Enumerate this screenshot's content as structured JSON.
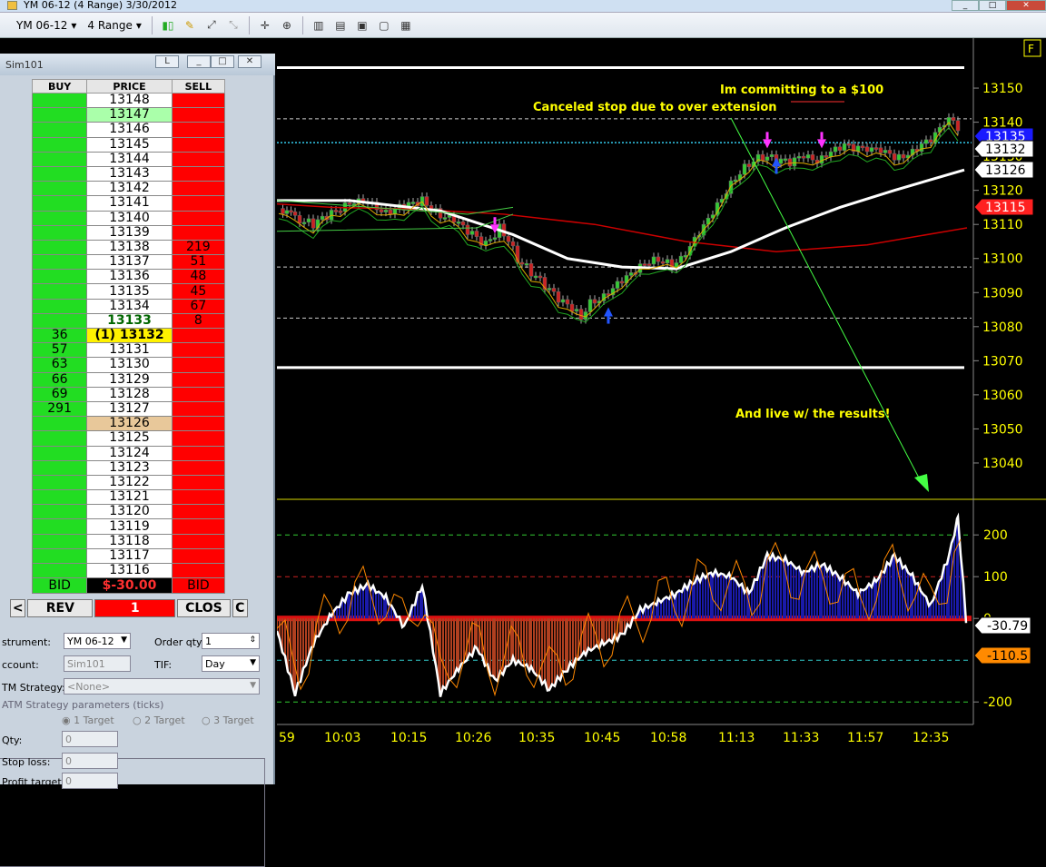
{
  "window": {
    "title": "YM 06-12 (4 Range)  3/30/2012"
  },
  "toolbar": {
    "instrument": "YM 06-12",
    "bar_type": "4 Range"
  },
  "dom": {
    "title": "Sim101",
    "link_button": "L",
    "headers": {
      "buy": "BUY",
      "price": "PRICE",
      "sell": "SELL"
    },
    "rows": [
      {
        "buy": "",
        "price": "13148",
        "sell": ""
      },
      {
        "buy": "",
        "price": "13147",
        "sell": "",
        "style": "last"
      },
      {
        "buy": "",
        "price": "13146",
        "sell": ""
      },
      {
        "buy": "",
        "price": "13145",
        "sell": ""
      },
      {
        "buy": "",
        "price": "13144",
        "sell": ""
      },
      {
        "buy": "",
        "price": "13143",
        "sell": ""
      },
      {
        "buy": "",
        "price": "13142",
        "sell": ""
      },
      {
        "buy": "",
        "price": "13141",
        "sell": ""
      },
      {
        "buy": "",
        "price": "13140",
        "sell": ""
      },
      {
        "buy": "",
        "price": "13139",
        "sell": ""
      },
      {
        "buy": "",
        "price": "13138",
        "sell": "219"
      },
      {
        "buy": "",
        "price": "13137",
        "sell": "51"
      },
      {
        "buy": "",
        "price": "13136",
        "sell": "48"
      },
      {
        "buy": "",
        "price": "13135",
        "sell": "45"
      },
      {
        "buy": "",
        "price": "13134",
        "sell": "67"
      },
      {
        "buy": "",
        "price": "13133",
        "sell": "8",
        "style": "grn"
      },
      {
        "buy": "36",
        "price": "(1) 13132",
        "sell": "",
        "style": "cur"
      },
      {
        "buy": "57",
        "price": "13131",
        "sell": ""
      },
      {
        "buy": "63",
        "price": "13130",
        "sell": ""
      },
      {
        "buy": "66",
        "price": "13129",
        "sell": ""
      },
      {
        "buy": "69",
        "price": "13128",
        "sell": ""
      },
      {
        "buy": "291",
        "price": "13127",
        "sell": ""
      },
      {
        "buy": "",
        "price": "13126",
        "sell": "",
        "style": "tan"
      },
      {
        "buy": "",
        "price": "13125",
        "sell": ""
      },
      {
        "buy": "",
        "price": "13124",
        "sell": ""
      },
      {
        "buy": "",
        "price": "13123",
        "sell": ""
      },
      {
        "buy": "",
        "price": "13122",
        "sell": ""
      },
      {
        "buy": "",
        "price": "13121",
        "sell": ""
      },
      {
        "buy": "",
        "price": "13120",
        "sell": ""
      },
      {
        "buy": "",
        "price": "13119",
        "sell": ""
      },
      {
        "buy": "",
        "price": "13118",
        "sell": ""
      },
      {
        "buy": "",
        "price": "13117",
        "sell": ""
      },
      {
        "buy": "",
        "price": "13116",
        "sell": ""
      }
    ],
    "footer": {
      "bid_left": "BID",
      "pnl": "$-30.00",
      "bid_right": "BID"
    },
    "controls": {
      "left": "<",
      "rev": "REV",
      "qty": "1",
      "close": "CLOS",
      "right": "C"
    }
  },
  "order_form": {
    "instrument_label": "strument:",
    "instrument_value": "YM 06-12",
    "order_qty_label": "Order qty:",
    "order_qty_value": "1",
    "account_label": "ccount:",
    "account_value": "Sim101",
    "tif_label": "TIF:",
    "tif_value": "Day",
    "atm_label": "TM Strategy:",
    "atm_value": "<None>",
    "atm_params_label": "ATM Strategy parameters (ticks)",
    "targets": [
      "1 Target",
      "2 Target",
      "3 Target"
    ],
    "qty_label": "Qty:",
    "qty_value": "0",
    "stop_label": "Stop loss:",
    "stop_value": "0",
    "profit_label": "Profit target:",
    "profit_value": "0"
  },
  "chart_data": {
    "type": "line",
    "title": "",
    "price_axis": {
      "ticks": [
        13150,
        13140,
        13130,
        13120,
        13110,
        13100,
        13090,
        13080,
        13070,
        13060,
        13050,
        13040
      ],
      "range": [
        13032,
        13162
      ]
    },
    "price_markers": [
      {
        "value": "13135",
        "color": "#1a1aff"
      },
      {
        "value": "13132",
        "color": "#ffffff"
      },
      {
        "value": "13126",
        "color": "#ffffff"
      },
      {
        "value": "13115",
        "color": "#ff2020"
      }
    ],
    "indicator_axis": {
      "ticks": [
        "200",
        "100",
        "0",
        "-200"
      ],
      "range": [
        -230,
        270
      ]
    },
    "indicator_markers": [
      {
        "value": "-30.79",
        "color": "#ffffff"
      },
      {
        "value": "-110.5",
        "color": "#ff8a00"
      }
    ],
    "time_labels": [
      "59",
      "10:03",
      "10:15",
      "10:26",
      "10:35",
      "10:45",
      "10:58",
      "11:13",
      "11:33",
      "11:57",
      "12:35"
    ],
    "horizontal_levels": [
      {
        "value": 13156,
        "style": "solid-white"
      },
      {
        "value": 13141,
        "style": "dash"
      },
      {
        "value": 13097.5,
        "style": "dash"
      },
      {
        "value": 13082.5,
        "style": "dash"
      },
      {
        "value": 13068,
        "style": "solid-white"
      }
    ],
    "annotations": [
      "Im committing to a $100",
      "Canceled stop due to over extension",
      "And live w/ the results!"
    ],
    "panel_flag": "F"
  }
}
